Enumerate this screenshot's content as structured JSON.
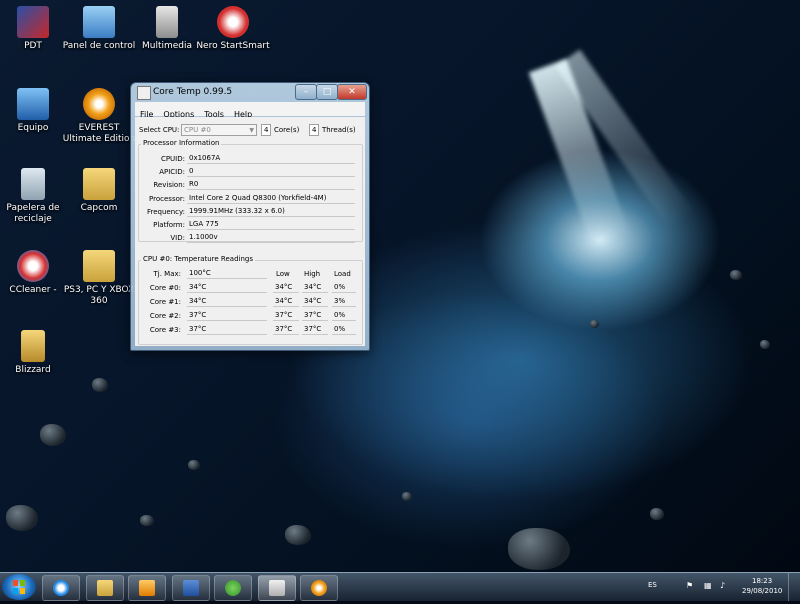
{
  "desktop": {
    "icons": [
      {
        "label": "PDT"
      },
      {
        "label": "Panel de control"
      },
      {
        "label": "Multimedia"
      },
      {
        "label": "Nero StartSmart"
      },
      {
        "label": "Equipo"
      },
      {
        "label": "EVEREST Ultimate Edition"
      },
      {
        "label": "Papelera de reciclaje"
      },
      {
        "label": "Capcom"
      },
      {
        "label": "CCleaner -"
      },
      {
        "label": "PS3, PC Y XBOX 360"
      },
      {
        "label": "Blizzard"
      }
    ]
  },
  "window": {
    "title": "Core Temp 0.99.5",
    "menu": [
      "File",
      "Options",
      "Tools",
      "Help"
    ],
    "select_cpu_label": "Select CPU:",
    "select_cpu_value": "CPU #0",
    "cores_count": "4",
    "cores_label": "Core(s)",
    "threads_count": "4",
    "threads_label": "Thread(s)",
    "processor_group_title": "Processor Information",
    "proc_rows": [
      {
        "label": "CPUID:",
        "value": "0x1067A"
      },
      {
        "label": "APICID:",
        "value": "0"
      },
      {
        "label": "Revision:",
        "value": "R0"
      },
      {
        "label": "Processor:",
        "value": "Intel Core 2 Quad Q8300 (Yorkfield-4M)"
      },
      {
        "label": "Frequency:",
        "value": "1999.91MHz (333.32 x 6.0)"
      },
      {
        "label": "Platform:",
        "value": "LGA 775"
      },
      {
        "label": "VID:",
        "value": "1.1000v"
      }
    ],
    "temp_group_title": "CPU #0: Temperature Readings",
    "tjmax_label": "Tj. Max:",
    "tjmax_value": "100°C",
    "col_low": "Low",
    "col_high": "High",
    "col_load": "Load",
    "cores": [
      {
        "label": "Core #0:",
        "temp": "34°C",
        "low": "34°C",
        "high": "34°C",
        "load": "0%"
      },
      {
        "label": "Core #1:",
        "temp": "34°C",
        "low": "34°C",
        "high": "34°C",
        "load": "3%"
      },
      {
        "label": "Core #2:",
        "temp": "37°C",
        "low": "37°C",
        "high": "37°C",
        "load": "0%"
      },
      {
        "label": "Core #3:",
        "temp": "37°C",
        "low": "37°C",
        "high": "37°C",
        "load": "0%"
      }
    ]
  },
  "taskbar": {
    "lang": "ES",
    "time": "18:23",
    "date": "29/08/2010"
  }
}
